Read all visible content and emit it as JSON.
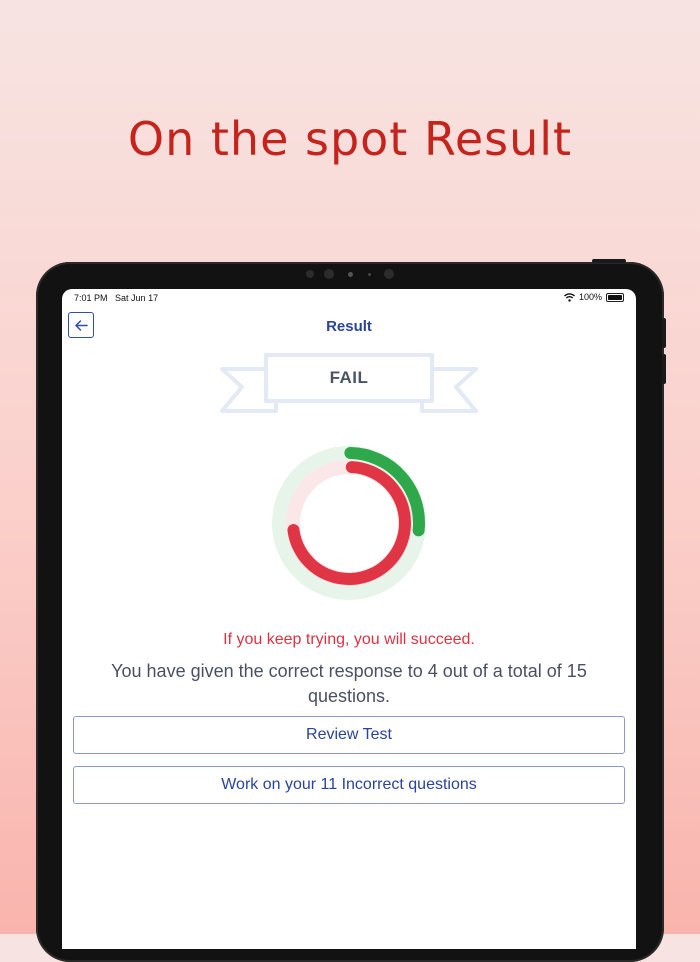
{
  "headline": "On the spot Result",
  "status_bar": {
    "time": "7:01 PM",
    "date": "Sat Jun 17",
    "battery": "100%",
    "wifi_icon": "wifi-icon",
    "battery_icon": "battery-icon"
  },
  "nav": {
    "title": "Result",
    "back_icon": "arrow-left-icon"
  },
  "result_badge": "FAIL",
  "score": {
    "correct": 4,
    "total": 15,
    "correct_fraction": 0.267,
    "correct_color": "#2ea84a",
    "incorrect_color": "#e03545"
  },
  "motivation_text": "If you keep trying, you will succeed.",
  "summary_text": "You have given the correct response to 4 out of a total of 15 questions.",
  "buttons": {
    "review": "Review Test",
    "incorrect": "Work on your 11 Incorrect questions"
  },
  "colors": {
    "headline": "#c4241c",
    "accent": "#2a449a",
    "fail_text": "#dc3344"
  }
}
